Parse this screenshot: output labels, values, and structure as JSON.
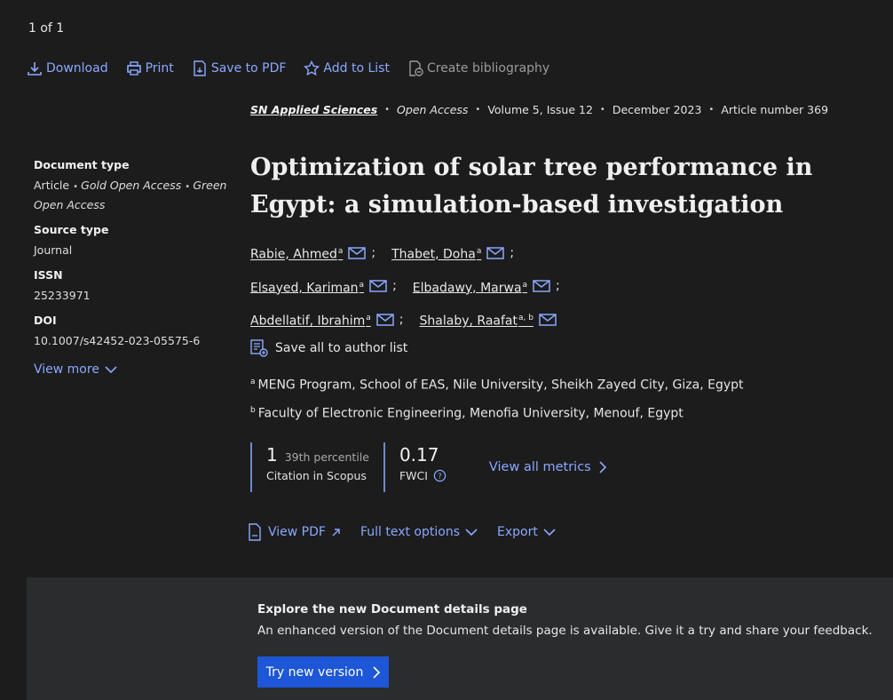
{
  "pager": "1  of 1",
  "toolbar": {
    "download": "Download",
    "print": "Print",
    "save_pdf": "Save to PDF",
    "add_list": "Add to List",
    "bibliography": "Create bibliography"
  },
  "source": {
    "journal": "SN Applied Sciences",
    "access": "Open Access",
    "volume": "Volume 5, Issue 12",
    "date": "December 2023",
    "article": "Article number 369"
  },
  "meta": {
    "doc_type_label": "Document type",
    "doc_type_article": "Article",
    "doc_type_gold": "Gold Open Access",
    "doc_type_green": "Green Open Access",
    "source_type_label": "Source type",
    "source_type": "Journal",
    "issn_label": "ISSN",
    "issn": "25233971",
    "doi_label": "DOI",
    "doi": "10.1007/s42452-023-05575-6",
    "view_more": "View more"
  },
  "title": "Optimization of solar tree performance in Egypt: a simulation-based investigation",
  "authors": [
    {
      "name": "Rabie, Ahmed",
      "sup": "a"
    },
    {
      "name": "Thabet, Doha",
      "sup": "a"
    },
    {
      "name": "Elsayed, Kariman",
      "sup": "a"
    },
    {
      "name": "Elbadawy, Marwa",
      "sup": "a"
    },
    {
      "name": "Abdellatif, Ibrahim",
      "sup": "a"
    },
    {
      "name": "Shalaby, Raafat",
      "sup": "a, b"
    }
  ],
  "save_all": "Save all to author list",
  "affiliations": [
    {
      "sup": "a",
      "text": "MENG Program, School of EAS, Nile University, Sheikh Zayed City, Giza, Egypt"
    },
    {
      "sup": "b",
      "text": "Faculty of Electronic Engineering, Menofia University, Menouf, Egypt"
    }
  ],
  "metrics": {
    "citations": "1",
    "percentile": "39th percentile",
    "citations_label": "Citation in Scopus",
    "fwci": "0.17",
    "fwci_label": "FWCI",
    "view_all": "View all metrics"
  },
  "actions": {
    "view_pdf": "View PDF",
    "full_text": "Full text options",
    "export": "Export"
  },
  "banner": {
    "heading": "Explore the new Document details page",
    "text": "An enhanced version of the Document details page is available. Give it a try and share your feedback.",
    "button": "Try new version"
  },
  "colors": {
    "link": "#8aa8ff",
    "button": "#1d56d6",
    "background": "#1c1c1c"
  }
}
